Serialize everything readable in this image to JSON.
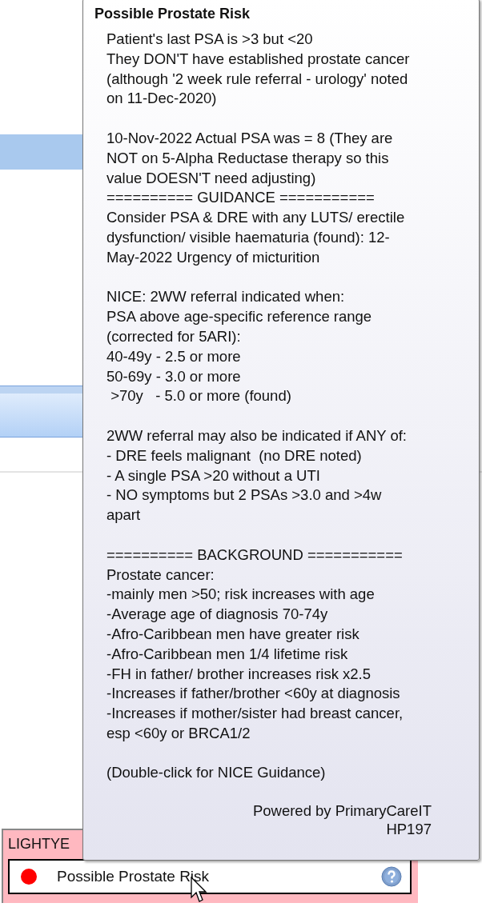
{
  "tooltip": {
    "title": "Possible Prostate Risk",
    "blocks": [
      [
        "Patient's last PSA is >3 but <20",
        "They DON'T have established prostate cancer",
        "(although '2 week rule referral - urology' noted",
        "on 11-Dec-2020)"
      ],
      [
        "10-Nov-2022 Actual PSA was = 8 (They are",
        "NOT on 5-Alpha Reductase therapy so this",
        "value DOESN'T need adjusting)",
        "========== GUIDANCE ===========",
        "Consider PSA & DRE with any LUTS/ erectile",
        "dysfunction/ visible haematuria (found): 12-",
        "May-2022 Urgency of micturition"
      ],
      [
        "NICE: 2WW referral indicated when:",
        "PSA above age-specific reference range",
        "(corrected for 5ARI):",
        "40-49y - 2.5 or more",
        "50-69y - 3.0 or more",
        " >70y   - 5.0 or more (found)"
      ],
      [
        "2WW referral may also be indicated if ANY of:",
        "- DRE feels malignant  (no DRE noted)",
        "- A single PSA >20 without a UTI",
        "- NO symptoms but 2 PSAs >3.0 and >4w",
        "apart"
      ],
      [
        "========== BACKGROUND ===========",
        "Prostate cancer:",
        "-mainly men >50; risk increases with age",
        "-Average age of diagnosis 70-74y",
        "-Afro-Caribbean men have greater risk",
        "-Afro-Caribbean men 1/4 lifetime risk",
        "-FH in father/ brother increases risk x2.5",
        "-Increases if father/brother <60y at diagnosis",
        "-Increases if mother/sister had breast cancer,",
        "esp <60y or BRCA1/2"
      ],
      [
        "(Double-click for NICE Guidance)"
      ]
    ],
    "footer": [
      "Powered by PrimaryCareIT",
      "HP197"
    ]
  },
  "panel": {
    "title": "LIGHTYE",
    "alert": {
      "text": "Possible Prostate Risk",
      "color": "#ff0000"
    }
  }
}
